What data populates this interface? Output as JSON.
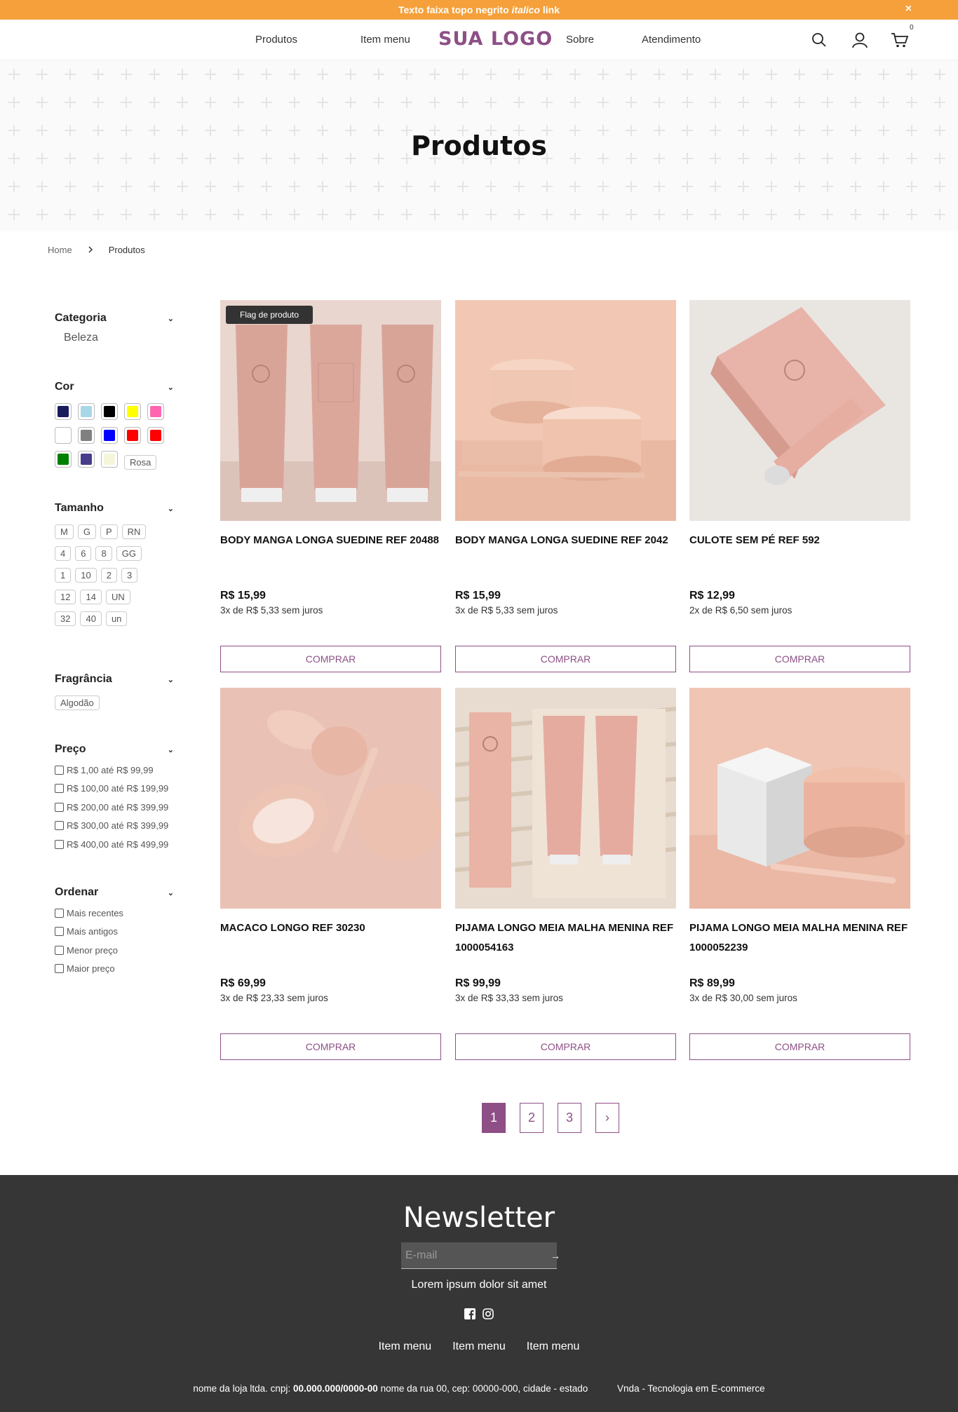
{
  "topbar": {
    "text_before": "Texto faixa topo negrito ",
    "text_italic": "italico",
    "text_after": " link",
    "close": "×"
  },
  "header": {
    "nav": [
      "Produtos",
      "Item menu",
      "Sobre",
      "Atendimento"
    ],
    "logo": "SUA LOGO",
    "cart_count": "0"
  },
  "hero": {
    "title": "Produtos"
  },
  "breadcrumb": {
    "home": "Home",
    "current": "Produtos"
  },
  "filters": {
    "categoria": {
      "title": "Categoria",
      "items": [
        "Beleza"
      ]
    },
    "cor": {
      "title": "Cor",
      "swatches": [
        "#1a1a5e",
        "#a8d8e8",
        "#000000",
        "#ffff00",
        "#ff66b2",
        "#ffffff",
        "#808080",
        "#0000ff",
        "#ff0000",
        "#ff0000",
        "#008000",
        "#483d8b",
        "#f5f5dc"
      ],
      "text_chip": "Rosa"
    },
    "tamanho": {
      "title": "Tamanho",
      "items": [
        "M",
        "G",
        "P",
        "RN",
        "4",
        "6",
        "8",
        "GG",
        "1",
        "10",
        "2",
        "3",
        "12",
        "14",
        "UN",
        "32",
        "40",
        "un"
      ]
    },
    "fragrancia": {
      "title": "Fragrância",
      "items": [
        "Algodão"
      ]
    },
    "preco": {
      "title": "Preço",
      "items": [
        "R$ 1,00 até R$ 99,99",
        "R$ 100,00 até R$ 199,99",
        "R$ 200,00 até R$ 399,99",
        "R$ 300,00 até R$ 399,99",
        "R$ 400,00 até R$ 499,99"
      ]
    },
    "ordenar": {
      "title": "Ordenar",
      "items": [
        "Mais recentes",
        "Mais antigos",
        "Menor preço",
        "Maior preço"
      ]
    }
  },
  "products": [
    {
      "name": "BODY MANGA LONGA SUEDINE REF 20488",
      "price": "R$ 15,99",
      "installments": "3x de R$ 5,33 sem juros",
      "flag": "Flag de produto",
      "button": "COMPRAR"
    },
    {
      "name": "BODY MANGA LONGA SUEDINE REF 2042",
      "price": "R$ 15,99",
      "installments": "3x de R$ 5,33 sem juros",
      "button": "COMPRAR"
    },
    {
      "name": "CULOTE SEM PÉ REF 592",
      "price": "R$ 12,99",
      "installments": "2x de R$ 6,50 sem juros",
      "button": "COMPRAR"
    },
    {
      "name": "MACACO LONGO REF 30230",
      "price": "R$ 69,99",
      "installments": "3x de R$ 23,33 sem juros",
      "button": "COMPRAR"
    },
    {
      "name": "PIJAMA LONGO MEIA MALHA MENINA REF 1000054163",
      "price": "R$ 99,99",
      "installments": "3x de R$ 33,33 sem juros",
      "button": "COMPRAR"
    },
    {
      "name": "PIJAMA LONGO MEIA MALHA MENINA REF 1000052239",
      "price": "R$ 89,99",
      "installments": "3x de R$ 30,00 sem juros",
      "button": "COMPRAR"
    }
  ],
  "pagination": {
    "pages": [
      "1",
      "2",
      "3"
    ],
    "next": "›",
    "current": "1"
  },
  "footer": {
    "newsletter_title": "Newsletter",
    "email_placeholder": "E-mail",
    "submit": "→",
    "description": "Lorem ipsum dolor sit amet",
    "menu": [
      "Item menu",
      "Item menu",
      "Item menu"
    ],
    "legal_prefix": "nome da loja ltda. cnpj: ",
    "cnpj": "00.000.000/0000-00",
    "legal_suffix": " nome da rua 00, cep: 00000-000, cidade - estado",
    "vnda": "Vnda - Tecnologia em E-commerce"
  },
  "colors": {
    "accent": "#8d4f86",
    "topbar": "#f5a03a",
    "footer": "#363636"
  }
}
